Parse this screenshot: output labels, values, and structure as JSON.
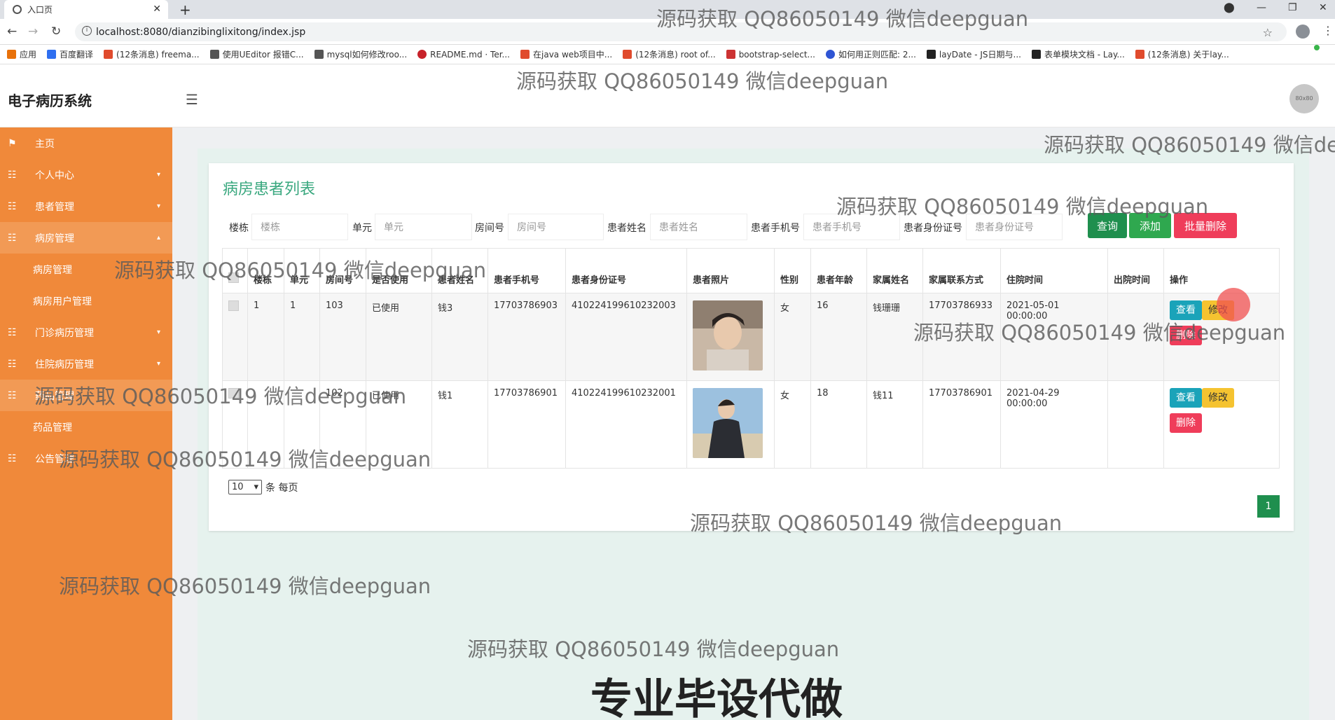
{
  "browser": {
    "tab_title": "入口页",
    "url": "localhost:8080/dianzibinglixitong/index.jsp",
    "bookmarks": [
      "应用",
      "百度翻译",
      "(12条消息) freema...",
      "使用UEditor 报错C...",
      "mysql如何修改roo...",
      "README.md · Ter...",
      "在java web项目中...",
      "(12条消息) root of...",
      "bootstrap-select...",
      "如何用正则匹配: 2...",
      "layDate - JS日期与...",
      "表单模块文档 - Lay...",
      "(12条消息) 关于lay..."
    ]
  },
  "header": {
    "brand": "电子病历系统",
    "avatar_text": "80x80"
  },
  "sidebar": {
    "items": [
      {
        "label": "主页"
      },
      {
        "label": "个人中心"
      },
      {
        "label": "患者管理"
      },
      {
        "label": "病房管理"
      },
      {
        "label": "病房管理"
      },
      {
        "label": "病房用户管理"
      },
      {
        "label": "门诊病历管理"
      },
      {
        "label": "住院病历管理"
      },
      {
        "label": "药品管理"
      },
      {
        "label": "药品管理"
      },
      {
        "label": "公告管理"
      }
    ]
  },
  "page": {
    "title": "病房患者列表",
    "filters": [
      {
        "label": "楼栋",
        "placeholder": "楼栋"
      },
      {
        "label": "单元",
        "placeholder": "单元"
      },
      {
        "label": "房间号",
        "placeholder": "房间号"
      },
      {
        "label": "患者姓名",
        "placeholder": "患者姓名"
      },
      {
        "label": "患者手机号",
        "placeholder": "患者手机号"
      },
      {
        "label": "患者身份证号",
        "placeholder": "患者身份证号"
      }
    ],
    "buttons": {
      "search": "查询",
      "add": "添加",
      "batch_delete": "批量删除"
    },
    "columns": [
      "楼栋",
      "单元",
      "房间号",
      "是否使用",
      "患者姓名",
      "患者手机号",
      "患者身份证号",
      "患者照片",
      "性别",
      "患者年龄",
      "家属姓名",
      "家属联系方式",
      "住院时间",
      "出院时间",
      "操作"
    ],
    "rows": [
      {
        "building": "1",
        "unit": "1",
        "room": "103",
        "used": "已使用",
        "name": "钱3",
        "phone": "17703786903",
        "id_card": "410224199610232003",
        "gender": "女",
        "age": "16",
        "family_name": "钱珊珊",
        "family_phone": "17703786933",
        "admit_time": "2021-05-01 00:00:00",
        "discharge_time": ""
      },
      {
        "building": "",
        "unit": "",
        "room": "102",
        "used": "已使用",
        "name": "钱1",
        "phone": "17703786901",
        "id_card": "410224199610232001",
        "gender": "女",
        "age": "18",
        "family_name": "钱11",
        "family_phone": "17703786901",
        "admit_time": "2021-04-29 00:00:00",
        "discharge_time": ""
      }
    ],
    "row_actions": {
      "view": "查看",
      "edit": "修改",
      "delete": "删除"
    },
    "page_size": "10",
    "page_size_suffix": "条 每页",
    "current_page": "1"
  },
  "watermark": {
    "text": "源码获取 QQ86050149 微信deepguan",
    "partial": "源码获取 QQ86050149 微信de",
    "big": "专业毕设代做"
  }
}
